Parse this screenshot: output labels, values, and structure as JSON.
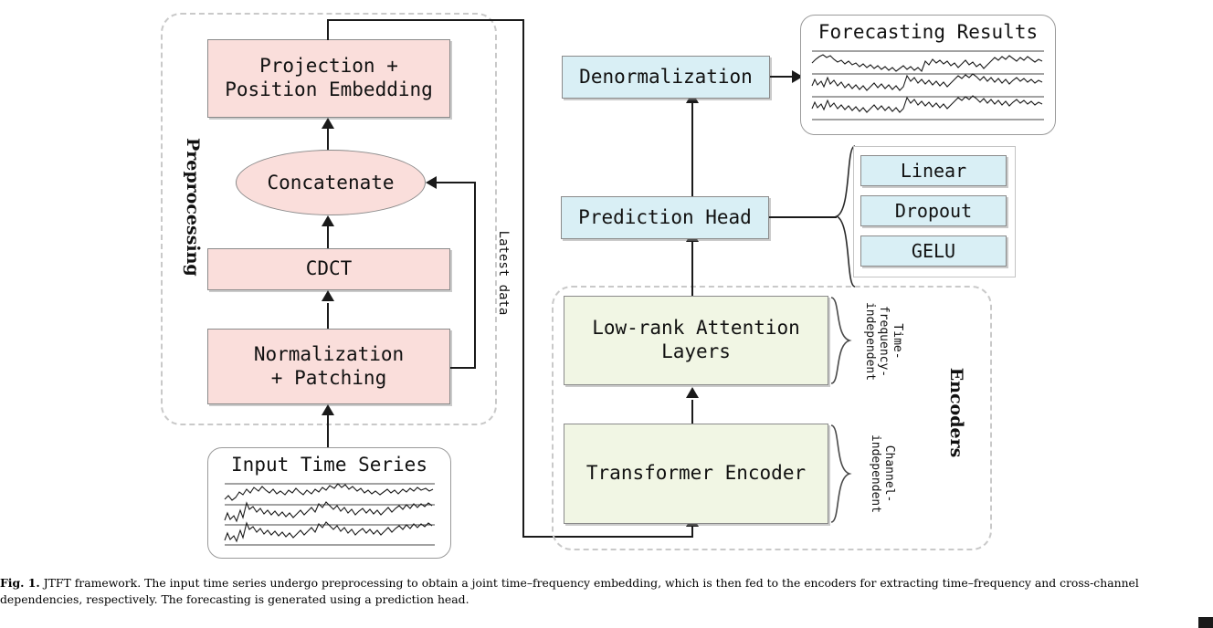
{
  "figure": {
    "caption_label": "Fig. 1.",
    "caption_text": "JTFT framework. The input time series undergo preprocessing to obtain a joint time–frequency embedding, which is then fed to the encoders for extracting time–frequency and cross-channel dependencies, respectively. The forecasting is generated using a prediction head."
  },
  "colors": {
    "pink": "#fadedb",
    "blue": "#d9eff5",
    "green": "#f1f6e4",
    "box_border": "#8a8a8a",
    "dashed_border": "#c9c9c9",
    "line": "#1a1a1a"
  },
  "preprocessing": {
    "group_label": "Preprocessing",
    "projection": "Projection +\nPosition Embedding",
    "concatenate": "Concatenate",
    "cdct": "CDCT",
    "normalization": "Normalization\n+ Patching",
    "feedback_label": "Latest data"
  },
  "input": {
    "title": "Input Time Series",
    "series_count": 3
  },
  "encoders": {
    "group_label": "Encoders",
    "low_rank": "Low-rank Attention\nLayers",
    "transformer": "Transformer Encoder",
    "brace_top_label": "Time-\nfrequency-\nindependent",
    "brace_bottom_label": "Channel-\nindependent"
  },
  "head": {
    "denormalization": "Denormalization",
    "prediction_head": "Prediction Head",
    "submodules": [
      "Linear",
      "Dropout",
      "GELU"
    ]
  },
  "output": {
    "title": "Forecasting Results",
    "series_count": 3
  }
}
